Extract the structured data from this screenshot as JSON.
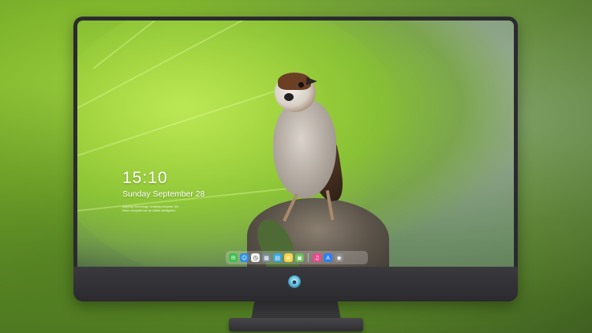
{
  "lockscreen": {
    "time": "15:10",
    "date": "Sunday September 28",
    "info_line_1": "Inspiring Technology: Amazing computer, the",
    "info_line_2": "future computer has an infinite intelligence"
  },
  "dock": {
    "icons": [
      {
        "name": "messages-icon",
        "glyph": "✉",
        "color": "#3fbf4f"
      },
      {
        "name": "finder-icon",
        "glyph": "☺",
        "color": "#2e8fe6"
      },
      {
        "name": "clock-icon",
        "glyph": "◷",
        "color": "#f2f2f2"
      },
      {
        "name": "preview-icon",
        "glyph": "▦",
        "color": "#7a8a9a"
      },
      {
        "name": "clapper-icon",
        "glyph": "▤",
        "color": "#38a8e0"
      },
      {
        "name": "notes-icon",
        "glyph": "≡",
        "color": "#f5d54a"
      },
      {
        "name": "photos-icon",
        "glyph": "▣",
        "color": "#6bbf59"
      },
      {
        "name": "music-icon",
        "glyph": "♫",
        "color": "#e84a8f"
      },
      {
        "name": "app-store-icon",
        "glyph": "A",
        "color": "#2f7ff0"
      },
      {
        "name": "camera-icon",
        "glyph": "◉",
        "color": "#8b8b8b"
      }
    ]
  },
  "brand": {
    "logo_icon": "mascot-logo-icon"
  }
}
